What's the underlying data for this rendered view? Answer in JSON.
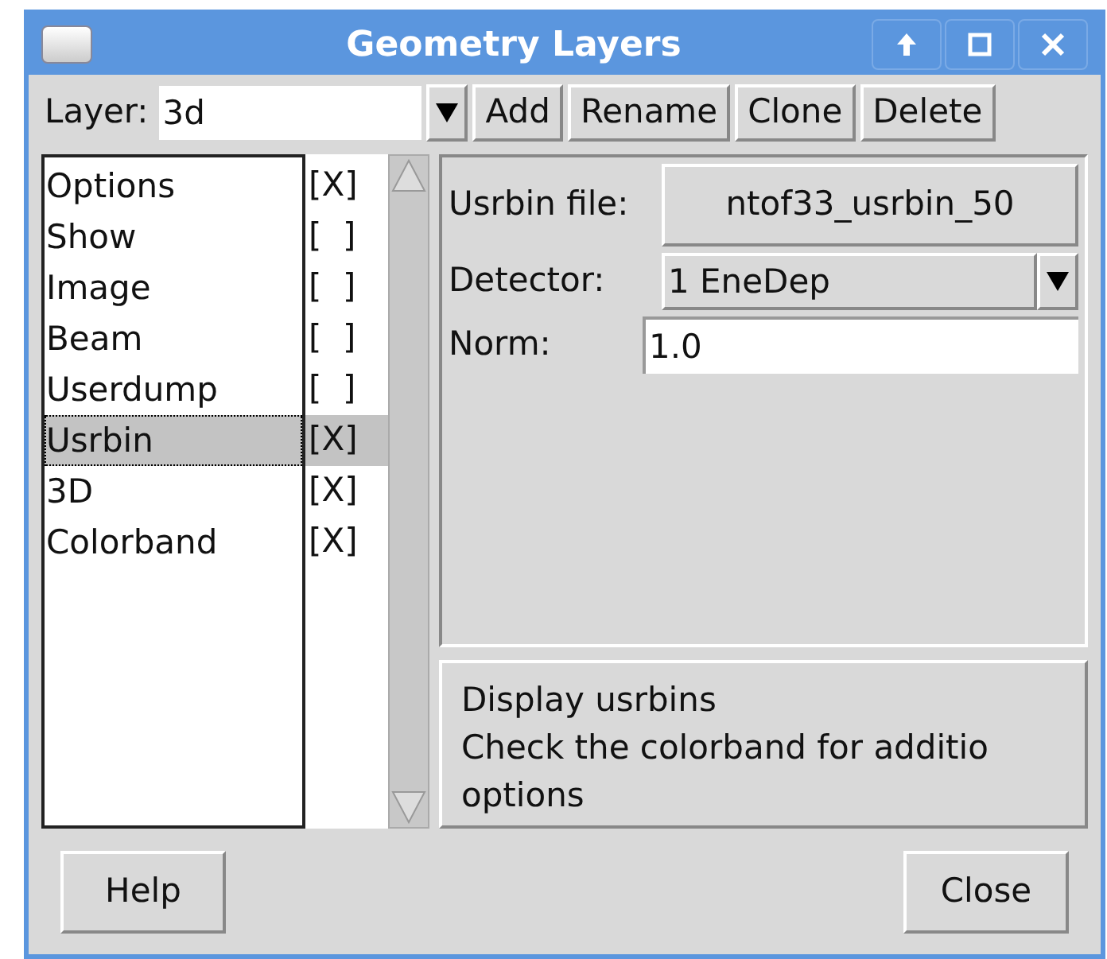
{
  "window": {
    "title": "Geometry Layers"
  },
  "toolbar": {
    "label": "Layer:",
    "value": "3d",
    "buttons": [
      "Add",
      "Rename",
      "Clone",
      "Delete"
    ]
  },
  "layers": [
    {
      "name": "Options",
      "mark": "[X]",
      "selected": false
    },
    {
      "name": "Show",
      "mark": "[  ]",
      "selected": false
    },
    {
      "name": "Image",
      "mark": "[  ]",
      "selected": false
    },
    {
      "name": "Beam",
      "mark": "[  ]",
      "selected": false
    },
    {
      "name": "Userdump",
      "mark": "[  ]",
      "selected": false
    },
    {
      "name": "Usrbin",
      "mark": "[X]",
      "selected": true
    },
    {
      "name": "3D",
      "mark": "[X]",
      "selected": false
    },
    {
      "name": "Colorband",
      "mark": "[X]",
      "selected": false
    }
  ],
  "form": [
    {
      "kind": "button",
      "label": "Usrbin file:",
      "value": "ntof33_usrbin_50"
    },
    {
      "kind": "combo",
      "label": "Detector:",
      "value": "1 EneDep"
    },
    {
      "kind": "entry",
      "label": "Norm:",
      "value": "1.0"
    }
  ],
  "description": [
    "Display usrbins",
    "Check the colorband for additio",
    "options"
  ],
  "buttons": [
    "Help",
    "Close"
  ]
}
